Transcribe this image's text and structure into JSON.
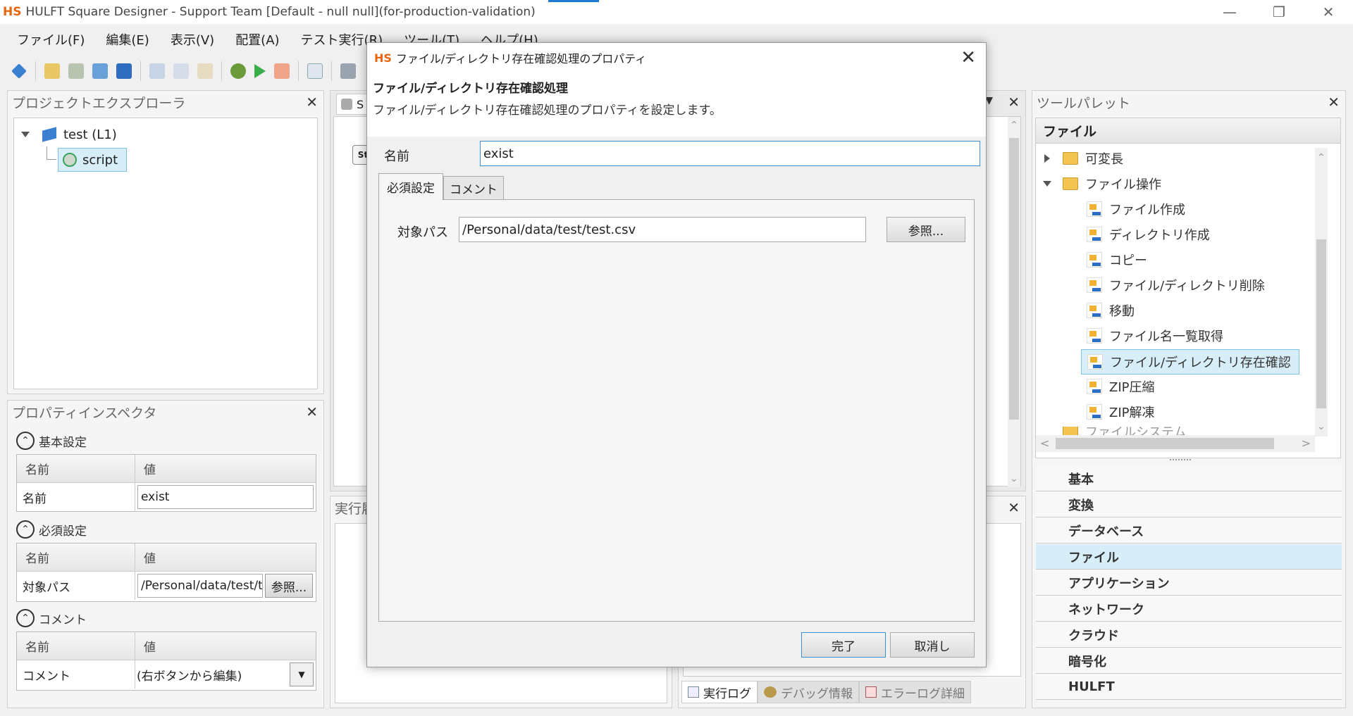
{
  "app": {
    "logo": "HS",
    "title": "HULFT Square Designer - Support Team [Default - null null](for-production-validation)"
  },
  "menu": [
    "ファイル(F)",
    "編集(E)",
    "表示(V)",
    "配置(A)",
    "テスト実行(R)",
    "ツール(T)",
    "ヘルプ(H)"
  ],
  "project_explorer": {
    "title": "プロジェクトエクスプローラ",
    "project": "test (L1)",
    "script": "script"
  },
  "property_inspector": {
    "title": "プロパティインスペクタ",
    "col_name": "名前",
    "col_value": "値",
    "sections": [
      {
        "title": "基本設定",
        "row_label": "名前",
        "row_value": "exist"
      },
      {
        "title": "必須設定",
        "row_label": "対象パス",
        "row_value": "/Personal/data/test/t",
        "button": "参照..."
      },
      {
        "title": "コメント",
        "row_label": "コメント",
        "row_value": "(右ボタンから編集)"
      }
    ]
  },
  "editor": {
    "tab_label": "S",
    "start_label": "St",
    "exec_panel_title": "実行履"
  },
  "log_tabs": [
    "実行ログ",
    "デバッグ情報",
    "エラーログ詳細"
  ],
  "tool_palette": {
    "title": "ツールパレット",
    "header": "ファイル",
    "folders": [
      "可変長",
      "ファイル操作",
      "ファイルシステム"
    ],
    "items": [
      "ファイル作成",
      "ディレクトリ作成",
      "コピー",
      "ファイル/ディレクトリ削除",
      "移動",
      "ファイル名一覧取得",
      "ファイル/ディレクトリ存在確認",
      "ZIP圧縮",
      "ZIP解凍"
    ],
    "categories": [
      "基本",
      "変換",
      "データベース",
      "ファイル",
      "アプリケーション",
      "ネットワーク",
      "クラウド",
      "暗号化",
      "HULFT"
    ]
  },
  "dialog": {
    "logo": "HS",
    "title": "ファイル/ディレクトリ存在確認処理のプロパティ",
    "heading": "ファイル/ディレクトリ存在確認処理",
    "description": "ファイル/ディレクトリ存在確認処理のプロパティを設定します。",
    "name_label": "名前",
    "name_value": "exist",
    "tabs": [
      "必須設定",
      "コメント"
    ],
    "path_label": "対象パス",
    "path_value": "/Personal/data/test/test.csv",
    "browse_button": "参照...",
    "ok_button": "完了",
    "cancel_button": "取消し"
  }
}
